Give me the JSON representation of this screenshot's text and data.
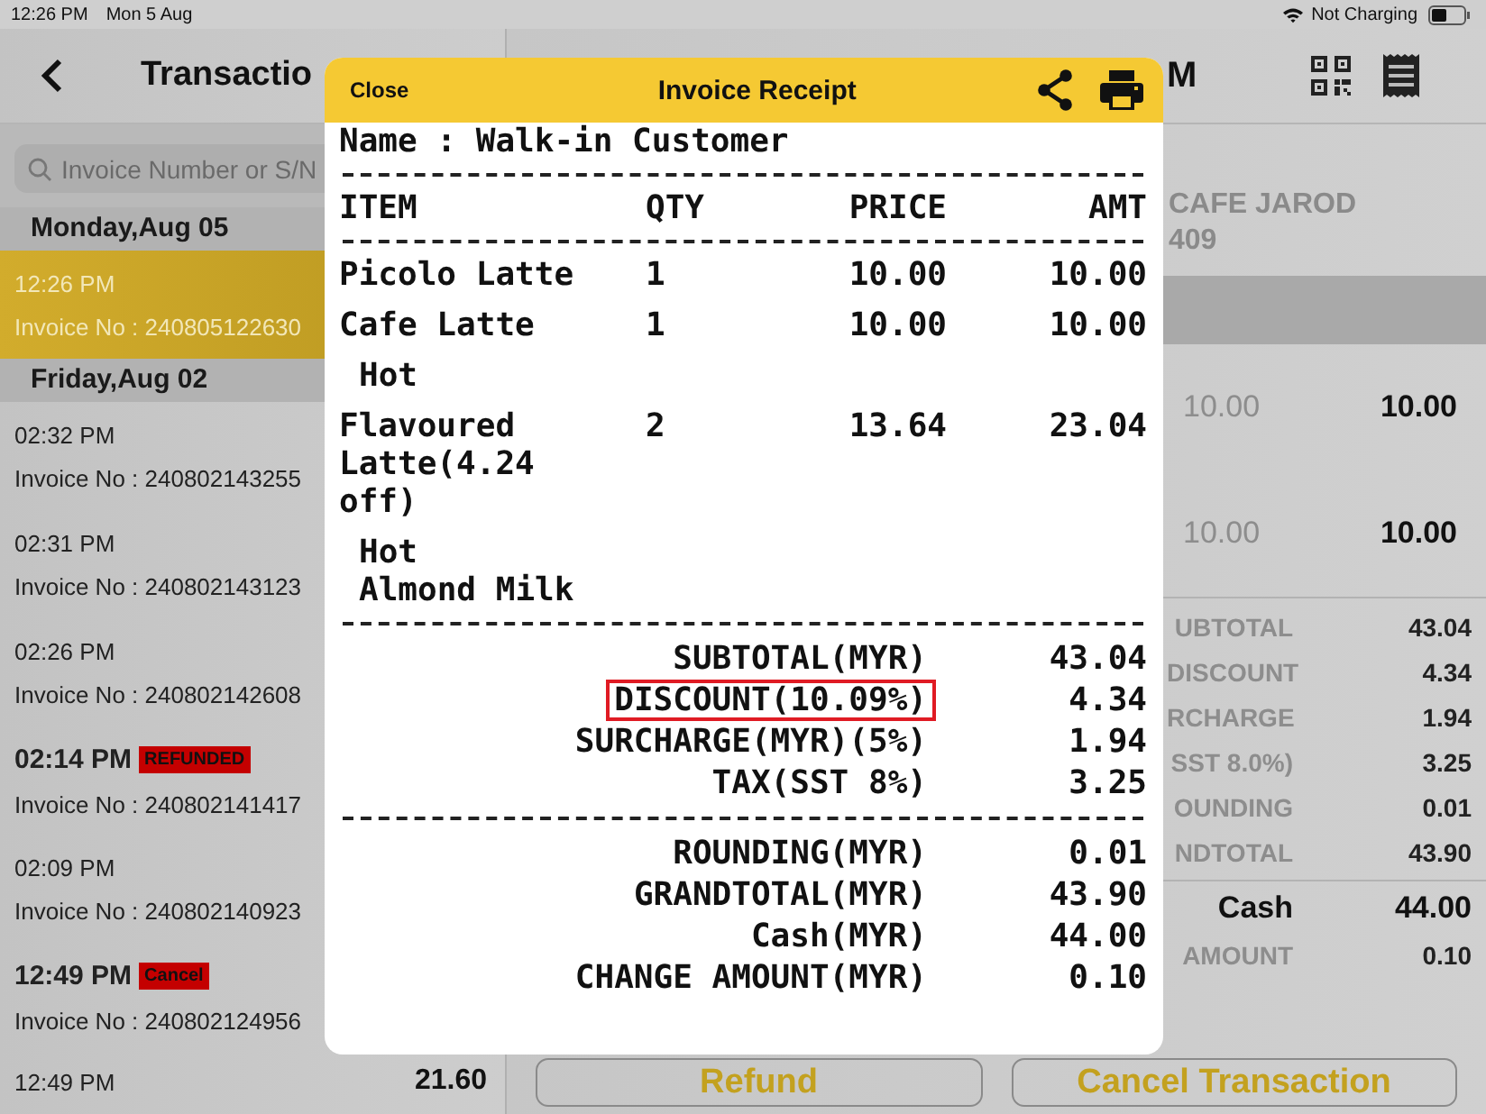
{
  "status_bar": {
    "time": "12:26 PM",
    "date": "Mon 5 Aug",
    "charging": "Not Charging"
  },
  "transactions_panel": {
    "title": "Transactio",
    "search": {
      "placeholder": "Invoice Number or S/N"
    },
    "sections": [
      {
        "date": "Monday,Aug 05",
        "transactions": [
          {
            "time": "12:26 PM",
            "invoice": "Invoice No : 240805122630",
            "selected": true
          }
        ]
      },
      {
        "date": "Friday,Aug 02",
        "transactions": [
          {
            "time": "02:32 PM",
            "invoice": "Invoice No : 240802143255",
            "selected": false
          },
          {
            "time": "02:31 PM",
            "invoice": "Invoice No : 240802143123",
            "selected": false
          },
          {
            "time": "02:26 PM",
            "invoice": "Invoice No : 240802142608",
            "selected": false
          },
          {
            "time": "02:14 PM",
            "badge": "REFUNDED",
            "invoice": "Invoice No : 240802141417",
            "selected": false
          },
          {
            "time": "02:09 PM",
            "invoice": "Invoice No : 240802140923",
            "selected": false
          },
          {
            "time": "12:49 PM",
            "badge": "Cancel",
            "invoice": "Invoice No : 240802124956",
            "selected": false
          },
          {
            "time": "12:49 PM",
            "amount": "21.60",
            "selected": false
          }
        ]
      }
    ]
  },
  "detail_panel": {
    "title": "M",
    "store": "CAFE JAROD",
    "store_code": "409",
    "items": [
      {
        "price": "10.00",
        "amount": "10.00"
      },
      {
        "price": "10.00",
        "amount": "10.00"
      }
    ],
    "summary": [
      {
        "label": "UBTOTAL",
        "value": "43.04"
      },
      {
        "label": "DISCOUNT",
        "value": "4.34"
      },
      {
        "label": "RCHARGE",
        "value": "1.94"
      },
      {
        "label": "SST 8.0%)",
        "value": "3.25"
      },
      {
        "label": "OUNDING",
        "value": "0.01"
      },
      {
        "label": "NDTOTAL",
        "value": "43.90"
      }
    ],
    "payment": [
      {
        "label": "Cash",
        "value": "44.00",
        "kind": "emphasis"
      },
      {
        "label": "AMOUNT",
        "value": "0.10",
        "kind": "plain"
      }
    ],
    "buttons": [
      "Refund",
      "Cancel Transaction"
    ]
  },
  "receipt": {
    "close": "Close",
    "title": "Invoice Receipt",
    "customer": "Name : Walk-in Customer",
    "columns": [
      "ITEM",
      "QTY",
      "PRICE",
      "AMT"
    ],
    "items": [
      {
        "name": "Picolo Latte",
        "qty": "1",
        "price": "10.00",
        "amount": "10.00"
      },
      {
        "name": "Cafe Latte",
        "qty": "1",
        "price": "10.00",
        "amount": "10.00",
        "modifiers": [
          "Hot"
        ]
      },
      {
        "name": "Flavoured Latte(4.24 off)",
        "qty": "2",
        "price": "13.64",
        "amount": "23.04",
        "modifiers": [
          "Hot",
          "Almond Milk"
        ]
      }
    ],
    "summary_groups": [
      {
        "rows": [
          {
            "label": "SUBTOTAL(MYR)",
            "value": "43.04",
            "highlighted": false
          },
          {
            "label": "DISCOUNT(10.09%)",
            "value": "4.34",
            "highlighted": true
          },
          {
            "label": "SURCHARGE(MYR)(5%)",
            "value": "1.94",
            "highlighted": false
          },
          {
            "label": "TAX(SST 8%)",
            "value": "3.25",
            "highlighted": false
          }
        ]
      },
      {
        "rows": [
          {
            "label": "ROUNDING(MYR)",
            "value": "0.01",
            "highlighted": false
          },
          {
            "label": "GRANDTOTAL(MYR)",
            "value": "43.90",
            "highlighted": false
          },
          {
            "label": "Cash(MYR)",
            "value": "44.00",
            "highlighted": false
          },
          {
            "label": "CHANGE AMOUNT(MYR)",
            "value": "0.10",
            "highlighted": false
          }
        ]
      }
    ]
  }
}
